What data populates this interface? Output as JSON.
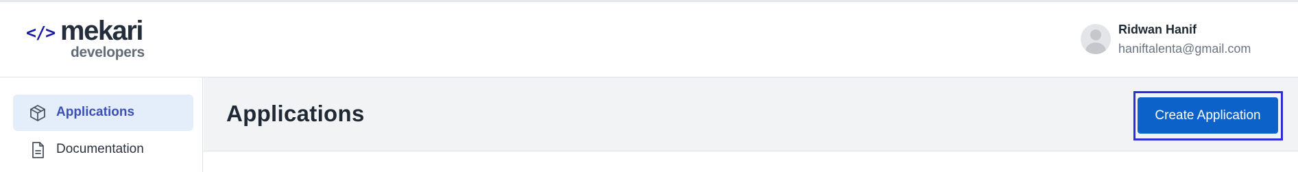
{
  "header": {
    "logo": {
      "code_mark": "</>",
      "brand": "mekari",
      "sub": "developers"
    },
    "user": {
      "name": "Ridwan Hanif",
      "email": "haniftalenta@gmail.com",
      "avatar_icon": "user-avatar-icon"
    }
  },
  "sidebar": {
    "items": [
      {
        "label": "Applications",
        "icon": "box-icon",
        "active": true
      },
      {
        "label": "Documentation",
        "icon": "document-icon",
        "active": false
      }
    ]
  },
  "main": {
    "title": "Applications",
    "create_button_label": "Create Application"
  },
  "colors": {
    "brand_blue": "#0d62c9",
    "active_nav_bg": "#e4eefb",
    "active_nav_text": "#3a4fb8",
    "highlight_border": "#2a2fd6"
  }
}
